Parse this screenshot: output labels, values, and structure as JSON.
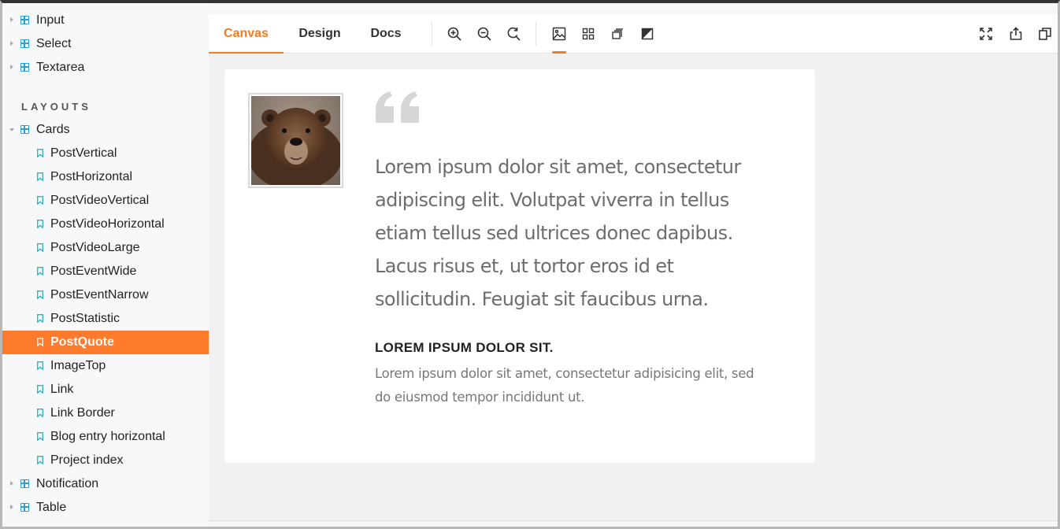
{
  "sidebar": {
    "top_items": [
      {
        "label": "Input"
      },
      {
        "label": "Select"
      },
      {
        "label": "Textarea"
      }
    ],
    "section_title": "LAYOUTS",
    "cards_group": {
      "label": "Cards"
    },
    "cards_items": [
      {
        "label": "PostVertical"
      },
      {
        "label": "PostHorizontal"
      },
      {
        "label": "PostVideoVertical"
      },
      {
        "label": "PostVideoHorizontal"
      },
      {
        "label": "PostVideoLarge"
      },
      {
        "label": "PostEventWide"
      },
      {
        "label": "PostEventNarrow"
      },
      {
        "label": "PostStatistic"
      },
      {
        "label": "PostQuote"
      },
      {
        "label": "ImageTop"
      },
      {
        "label": "Link"
      },
      {
        "label": "Link Border"
      },
      {
        "label": "Blog entry horizontal"
      },
      {
        "label": "Project index"
      }
    ],
    "active_item": "PostQuote",
    "bottom_items": [
      {
        "label": "Notification"
      },
      {
        "label": "Table"
      }
    ]
  },
  "toolbar": {
    "tabs": [
      {
        "label": "Canvas"
      },
      {
        "label": "Design"
      },
      {
        "label": "Docs"
      }
    ],
    "active_tab": "Canvas",
    "zoom_buttons": [
      "zoom-in-icon",
      "zoom-out-icon",
      "reset-zoom-icon"
    ],
    "view_buttons": [
      "image-background-icon",
      "grid-icon",
      "layers-icon",
      "contrast-icon"
    ],
    "active_view": "image-background-icon",
    "right_buttons": [
      "fullscreen-icon",
      "share-icon",
      "copy-icon"
    ]
  },
  "card": {
    "avatar_alt": "bear",
    "quote_text": "Lorem ipsum dolor sit amet, consectetur adipiscing elit. Volutpat viverra in tellus etiam tellus sed ultrices donec dapibus. Lacus risus et, ut tortor eros id et sollicitudin. Feugiat sit faucibus urna.",
    "author_name": "LOREM IPSUM DOLOR SIT.",
    "author_description": "Lorem ipsum dolor sit amet, consectetur adipisicing elit, sed do eiusmod tempor incididunt ut."
  },
  "colors": {
    "accent": "#f47b20",
    "active_bg": "#fe7a2d",
    "tree_icon": "#2a9fd6",
    "leaf_icon": "#26b5c5"
  }
}
